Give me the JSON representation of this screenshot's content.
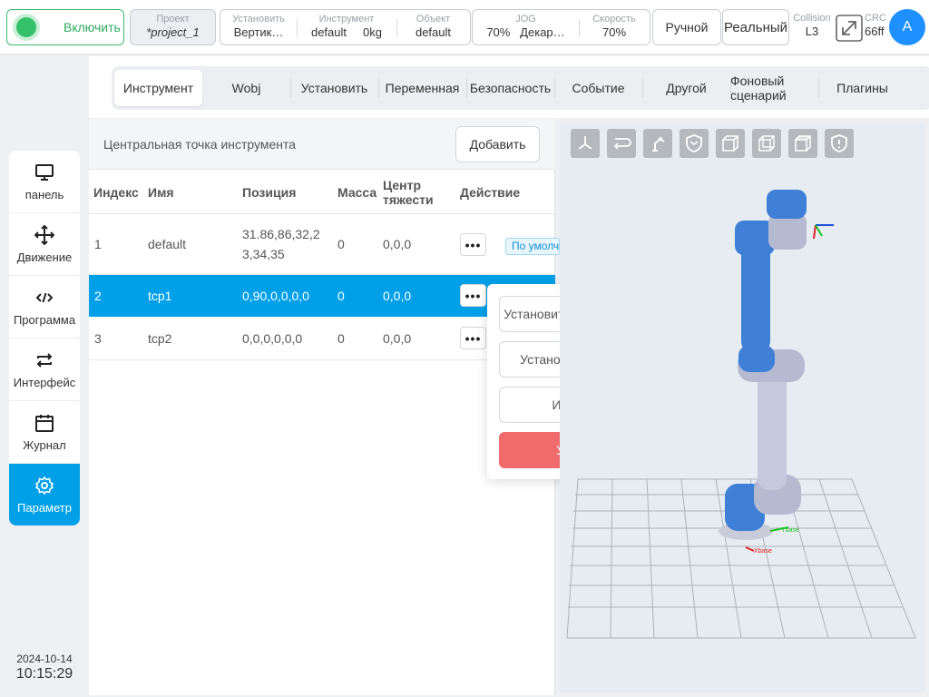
{
  "topbar": {
    "power_label": "Включить",
    "project_label": "Проект",
    "project_value": "*project_1",
    "setup": [
      {
        "label": "Установить",
        "value": "Вертик…"
      },
      {
        "label": "Инструмент",
        "value": "default     0kg"
      },
      {
        "label": "Объект",
        "value": "default"
      }
    ],
    "jog": [
      {
        "label": "JOG",
        "value": "70%   Декар…"
      },
      {
        "label": "Скорость",
        "value": "70%"
      }
    ],
    "mode": "Ручной",
    "real": "Реальный",
    "collision_label": "Collision",
    "collision_value": "L3",
    "crc_label": "CRC",
    "crc_value": "66ff",
    "avatar": "A"
  },
  "nav": [
    {
      "label": "панель",
      "icon": "monitor-icon"
    },
    {
      "label": "Движение",
      "icon": "move-arrows-icon"
    },
    {
      "label": "Программа",
      "icon": "code-icon"
    },
    {
      "label": "Интерфейс",
      "icon": "swap-icon"
    },
    {
      "label": "Журнал",
      "icon": "calendar-icon"
    },
    {
      "label": "Параметр",
      "icon": "gear-icon",
      "active": true
    }
  ],
  "datetime": {
    "date": "2024-10-14",
    "time": "10:15:29"
  },
  "tabs": [
    {
      "label": "Инструмент",
      "active": true
    },
    {
      "label": "Wobj"
    },
    {
      "label": "Установить"
    },
    {
      "label": "Переменная"
    },
    {
      "label": "Безопасность"
    },
    {
      "label": "Событие"
    },
    {
      "label": "Другой"
    },
    {
      "label": "Фоновый сценарий"
    },
    {
      "label": "Плагины"
    }
  ],
  "tcp": {
    "title": "Центральная точка инструмента",
    "add_label": "Добавить",
    "columns": [
      "Индекс",
      "Имя",
      "Позиция",
      "Масса",
      "Центр тяжести",
      "Действие"
    ],
    "rows": [
      {
        "index": "1",
        "name": "default",
        "position": "31.86,86,32,23,34,35",
        "mass": "0",
        "cog": "0,0,0",
        "tag": "По умолчанию"
      },
      {
        "index": "2",
        "name": "tcp1",
        "position": "0,90,0,0,0,0",
        "mass": "0",
        "cog": "0,0,0",
        "selected": true
      },
      {
        "index": "3",
        "name": "tcp2",
        "position": "0,0,0,0,0,0",
        "mass": "0",
        "cog": "0,0,0"
      }
    ],
    "more_label": "•••"
  },
  "popup": {
    "set_default": "Установить по умолчанию",
    "set_current": "Установить текущим",
    "edit": "Изменить",
    "delete": "Удалить"
  },
  "viewer": {
    "tools": [
      "axis-view-icon",
      "path-icon",
      "robot-icon",
      "shield-icon",
      "cube-front-icon",
      "cube-side-icon",
      "cube-top-icon",
      "shield-alert-icon"
    ],
    "axis_x_label": "Xbase",
    "axis_y_label": "Ybase"
  },
  "colors": {
    "accent": "#00a0e9",
    "danger": "#f06b6b",
    "power": "#35c06a"
  }
}
